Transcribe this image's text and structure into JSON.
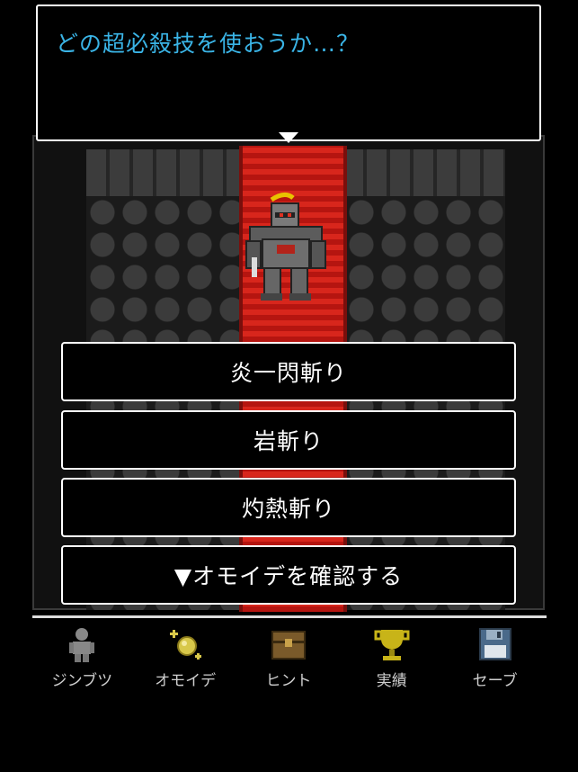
{
  "dialog": {
    "text": "どの超必殺技を使おうか…？"
  },
  "skills": [
    {
      "label": "炎一閃斬り"
    },
    {
      "label": "岩斬り"
    },
    {
      "label": "灼熱斬り"
    },
    {
      "label": "▼オモイデを確認する"
    }
  ],
  "nav": [
    {
      "label": "ジンブツ",
      "icon": "person-icon"
    },
    {
      "label": "オモイデ",
      "icon": "sparkle-orb-icon"
    },
    {
      "label": "ヒント",
      "icon": "treasure-chest-icon"
    },
    {
      "label": "実績",
      "icon": "trophy-icon"
    },
    {
      "label": "セーブ",
      "icon": "floppy-disk-icon"
    }
  ],
  "colors": {
    "dialog_text": "#3ab4e6",
    "carpet": "#d8261c",
    "background": "#000000"
  }
}
